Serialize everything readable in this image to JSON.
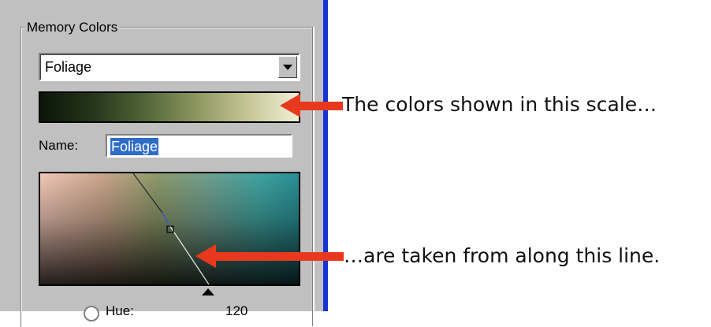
{
  "group": {
    "legend": "Memory Colors"
  },
  "dropdown": {
    "selected": "Foliage"
  },
  "name_field": {
    "label": "Name:",
    "value": "Foliage"
  },
  "hue": {
    "label": "Hue:",
    "value": "120"
  },
  "annotations": {
    "scale_note": "The colors shown in this scale…",
    "line_note": "…are taken from along this line."
  },
  "colors": {
    "panel": "#c0c0c0",
    "edge": "#1733d2",
    "arrow": "#e8391f",
    "selection": "#2e6cc7"
  },
  "icons": {
    "dropdown": "chevron-down-icon",
    "arrow": "arrow-left-icon",
    "pointer": "triangle-up-icon"
  }
}
